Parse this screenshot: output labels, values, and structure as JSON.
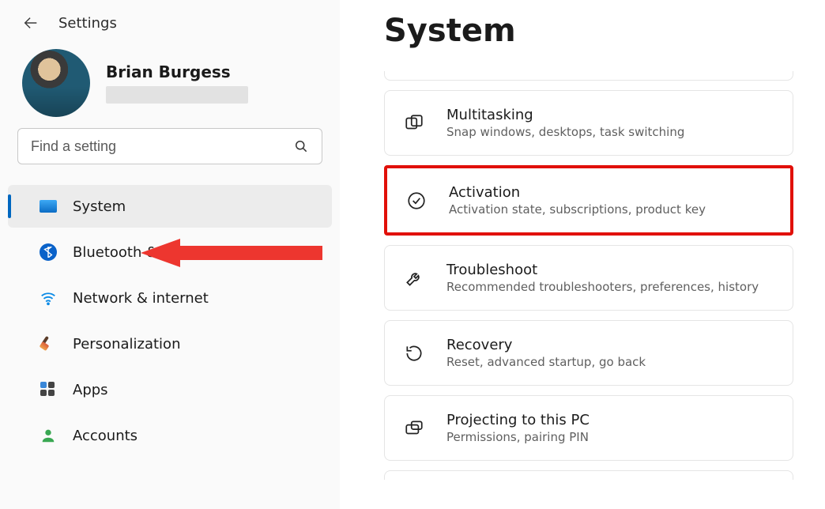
{
  "header": {
    "settings_label": "Settings"
  },
  "profile": {
    "name": "Brian Burgess"
  },
  "search": {
    "placeholder": "Find a setting"
  },
  "nav": {
    "items": [
      {
        "label": "System"
      },
      {
        "label": "Bluetooth & devices"
      },
      {
        "label": "Network & internet"
      },
      {
        "label": "Personalization"
      },
      {
        "label": "Apps"
      },
      {
        "label": "Accounts"
      }
    ]
  },
  "main": {
    "title": "System",
    "cards": {
      "multitasking": {
        "title": "Multitasking",
        "sub": "Snap windows, desktops, task switching"
      },
      "activation": {
        "title": "Activation",
        "sub": "Activation state, subscriptions, product key"
      },
      "troubleshoot": {
        "title": "Troubleshoot",
        "sub": "Recommended troubleshooters, preferences, history"
      },
      "recovery": {
        "title": "Recovery",
        "sub": "Reset, advanced startup, go back"
      },
      "projecting": {
        "title": "Projecting to this PC",
        "sub": "Permissions, pairing PIN"
      }
    }
  }
}
